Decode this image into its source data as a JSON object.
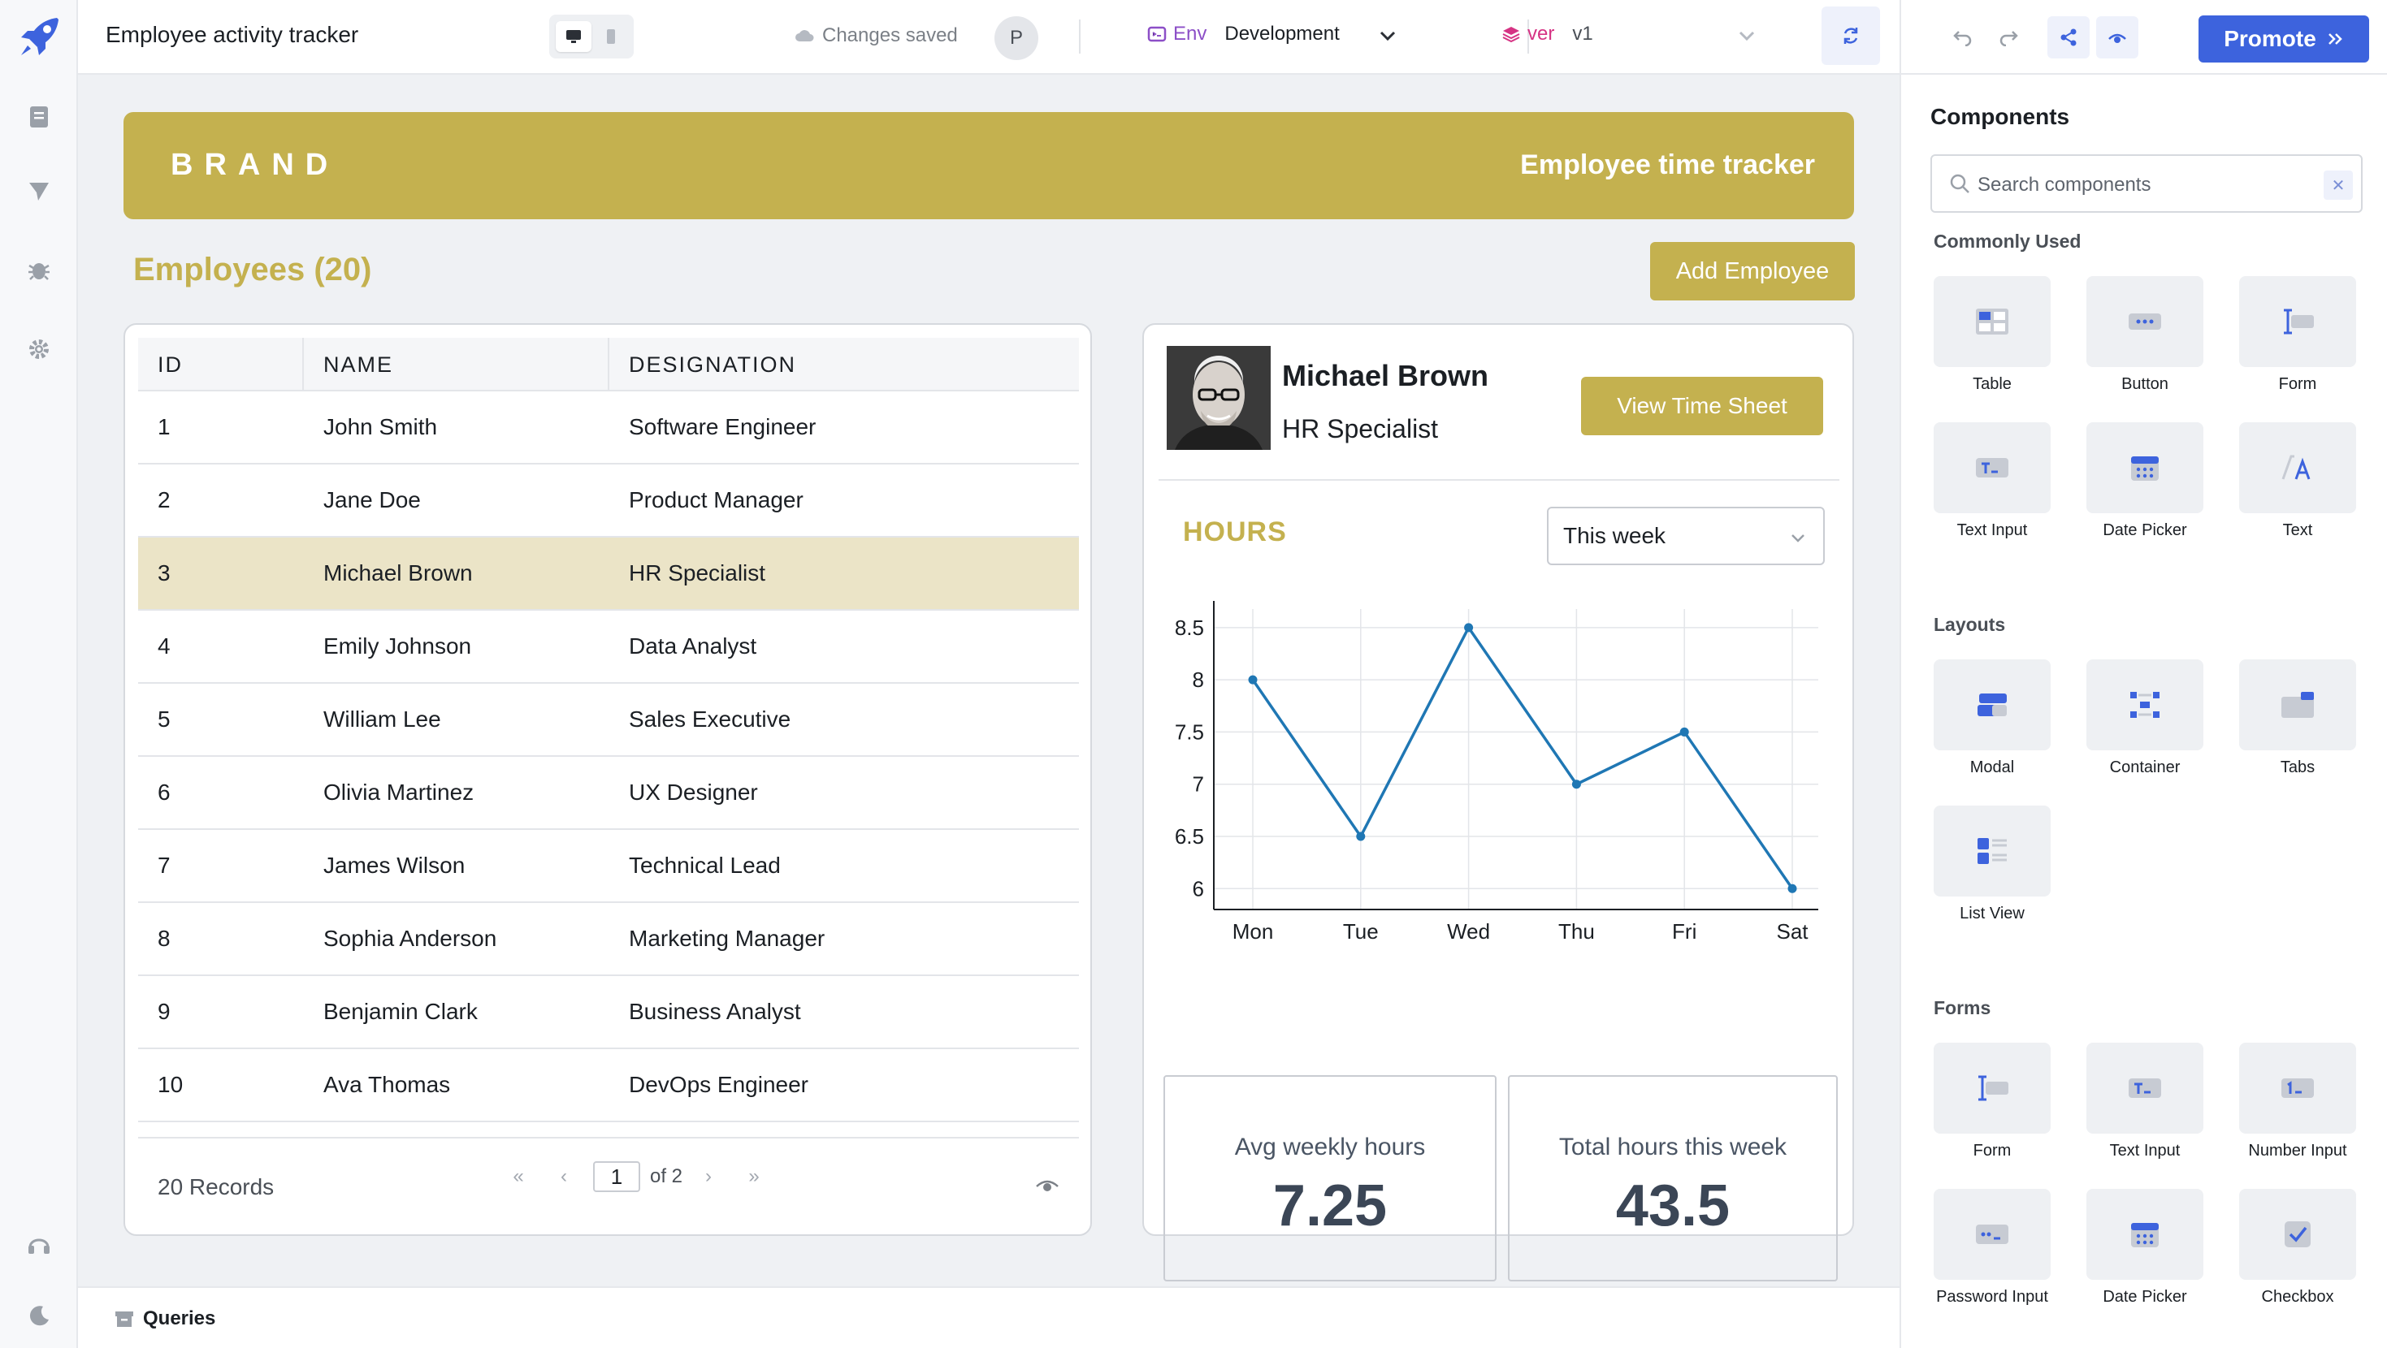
{
  "app": {
    "title": "Employee activity tracker",
    "save_status": "Changes saved",
    "user_initial": "P",
    "env_label": "Env",
    "env_value": "Development",
    "version_label": "ver",
    "version_value": "v1",
    "promote_label": "Promote"
  },
  "banner": {
    "brand": "BRAND",
    "subtitle": "Employee time tracker"
  },
  "employees": {
    "heading": "Employees (20)",
    "add_button": "Add Employee",
    "columns": [
      "ID",
      "NAME",
      "DESIGNATION"
    ],
    "rows": [
      [
        "1",
        "John Smith",
        "Software Engineer"
      ],
      [
        "2",
        "Jane Doe",
        "Product Manager"
      ],
      [
        "3",
        "Michael Brown",
        "HR Specialist"
      ],
      [
        "4",
        "Emily Johnson",
        "Data Analyst"
      ],
      [
        "5",
        "William Lee",
        "Sales Executive"
      ],
      [
        "6",
        "Olivia Martinez",
        "UX Designer"
      ],
      [
        "7",
        "James Wilson",
        "Technical Lead"
      ],
      [
        "8",
        "Sophia Anderson",
        "Marketing Manager"
      ],
      [
        "9",
        "Benjamin Clark",
        "Business Analyst"
      ],
      [
        "10",
        "Ava Thomas",
        "DevOps Engineer"
      ]
    ],
    "selected_row_index": 2,
    "records": "20 Records",
    "page": "1",
    "page_total": "of 2"
  },
  "detail": {
    "name": "Michael Brown",
    "designation": "HR Specialist",
    "view_button": "View Time Sheet",
    "hours_heading": "HOURS",
    "period": "This week",
    "stats": [
      {
        "label": "Avg weekly hours",
        "value": "7.25"
      },
      {
        "label": "Total hours this week",
        "value": "43.5"
      }
    ]
  },
  "chart_data": {
    "type": "line",
    "categories": [
      "Mon",
      "Tue",
      "Wed",
      "Thu",
      "Fri",
      "Sat"
    ],
    "values": [
      8,
      6.5,
      8.5,
      7,
      7.5,
      6
    ],
    "ylim": [
      5.8,
      8.6
    ],
    "yticks": [
      "8.5",
      "8",
      "7.5",
      "7",
      "6.5",
      "6"
    ],
    "grid": true,
    "color": "#1f77b4"
  },
  "queries": {
    "label": "Queries"
  },
  "panel": {
    "title": "Components",
    "search_placeholder": "Search components",
    "sections": {
      "common": "Commonly Used",
      "layouts": "Layouts",
      "forms": "Forms"
    },
    "common": [
      "Table",
      "Button",
      "Form",
      "Text Input",
      "Date Picker",
      "Text"
    ],
    "layouts": [
      "Modal",
      "Container",
      "Tabs",
      "List View"
    ],
    "forms": [
      "Form",
      "Text Input",
      "Number Input",
      "Password Input",
      "Date Picker",
      "Checkbox"
    ]
  },
  "colors": {
    "brand": "#c4b14f",
    "accent": "#3d63dd",
    "selected_row": "#ebe4c7"
  }
}
